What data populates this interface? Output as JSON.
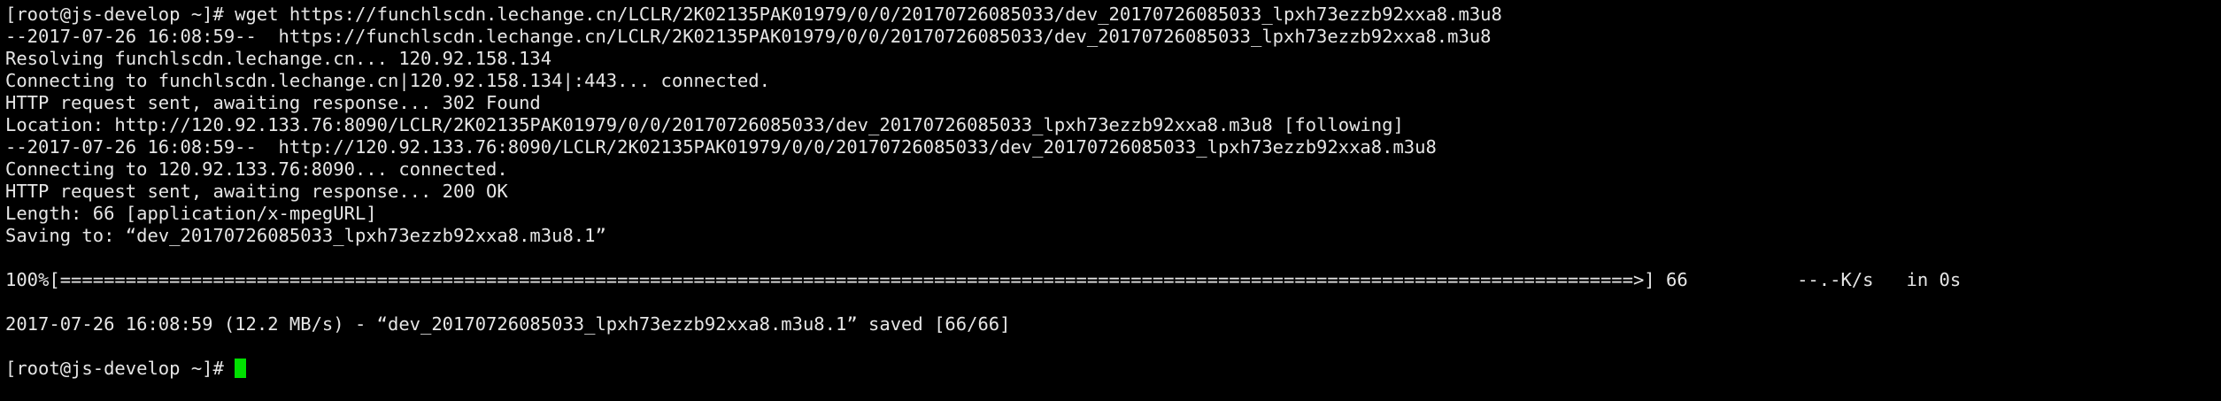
{
  "terminal": {
    "colors": {
      "background": "#000000",
      "text": "#e6e6e6",
      "cursor": "#00e000"
    },
    "lines": [
      "[root@js-develop ~]# wget https://funchlscdn.lechange.cn/LCLR/2K02135PAK01979/0/0/20170726085033/dev_20170726085033_lpxh73ezzb92xxa8.m3u8",
      "--2017-07-26 16:08:59--  https://funchlscdn.lechange.cn/LCLR/2K02135PAK01979/0/0/20170726085033/dev_20170726085033_lpxh73ezzb92xxa8.m3u8",
      "Resolving funchlscdn.lechange.cn... 120.92.158.134",
      "Connecting to funchlscdn.lechange.cn|120.92.158.134|:443... connected.",
      "HTTP request sent, awaiting response... 302 Found",
      "Location: http://120.92.133.76:8090/LCLR/2K02135PAK01979/0/0/20170726085033/dev_20170726085033_lpxh73ezzb92xxa8.m3u8 [following]",
      "--2017-07-26 16:08:59--  http://120.92.133.76:8090/LCLR/2K02135PAK01979/0/0/20170726085033/dev_20170726085033_lpxh73ezzb92xxa8.m3u8",
      "Connecting to 120.92.133.76:8090... connected.",
      "HTTP request sent, awaiting response... 200 OK",
      "Length: 66 [application/x-mpegURL]",
      "Saving to: “dev_20170726085033_lpxh73ezzb92xxa8.m3u8.1”",
      "",
      "100%[================================================================================================================================================>] 66          --.-K/s   in 0s",
      "",
      "2017-07-26 16:08:59 (12.2 MB/s) - “dev_20170726085033_lpxh73ezzb92xxa8.m3u8.1” saved [66/66]",
      ""
    ],
    "prompt": "[root@js-develop ~]# "
  }
}
